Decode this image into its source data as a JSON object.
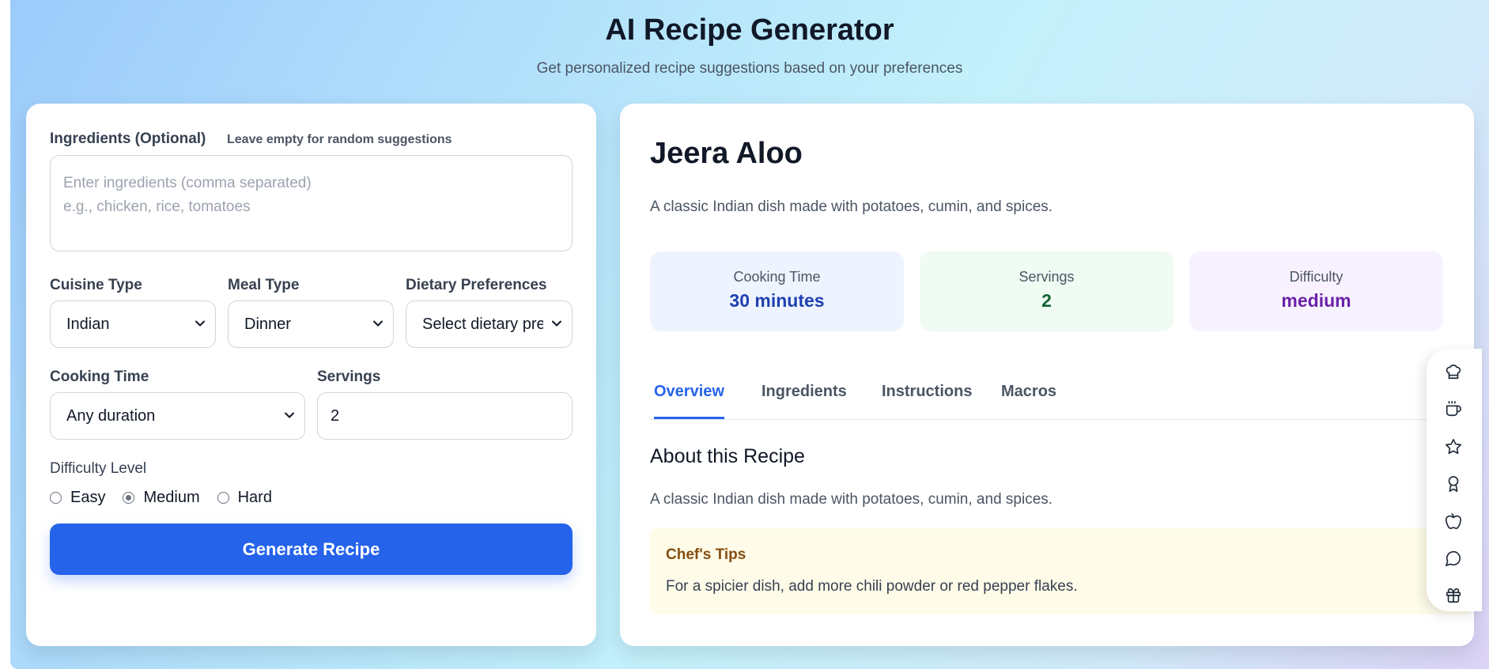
{
  "header": {
    "title": "AI Recipe Generator",
    "subtitle": "Get personalized recipe suggestions based on your preferences"
  },
  "form": {
    "ingredients_label": "Ingredients (Optional)",
    "ingredients_hint": "Leave empty for random suggestions",
    "ingredients_placeholder": "Enter ingredients (comma separated)\ne.g., chicken, rice, tomatoes",
    "ingredients_value": "",
    "cuisine_label": "Cuisine Type",
    "cuisine_value": "Indian",
    "meal_label": "Meal Type",
    "meal_value": "Dinner",
    "dietary_label": "Dietary Preferences",
    "dietary_value": "Select dietary preferences",
    "time_label": "Cooking Time",
    "time_value": "Any duration",
    "servings_label": "Servings",
    "servings_value": "2",
    "difficulty_label": "Difficulty Level",
    "difficulty_options": [
      "Easy",
      "Medium",
      "Hard"
    ],
    "difficulty_selected": "Medium",
    "generate_label": "Generate Recipe"
  },
  "recipe": {
    "title": "Jeera Aloo",
    "description": "A classic Indian dish made with potatoes, cumin, and spices.",
    "stats": {
      "time_label": "Cooking Time",
      "time_value": "30 minutes",
      "servings_label": "Servings",
      "servings_value": "2",
      "difficulty_label": "Difficulty",
      "difficulty_value": "medium"
    },
    "tabs": [
      "Overview",
      "Ingredients",
      "Instructions",
      "Macros"
    ],
    "active_tab": "Overview",
    "about_title": "About this Recipe",
    "about_text": "A classic Indian dish made with potatoes, cumin, and spices.",
    "tips_title": "Chef's Tips",
    "tips_text": "For a spicier dish, add more chili powder or red pepper flakes."
  },
  "sidebar": {
    "icons": [
      "chef-hat-icon",
      "coffee-icon",
      "star-icon",
      "award-icon",
      "apple-icon",
      "message-circle-icon",
      "gift-icon"
    ]
  },
  "colors": {
    "primary": "#2563eb",
    "time_value": "#1e40af",
    "servings_value": "#166534",
    "difficulty_value": "#6b21a8",
    "tips_title": "#854d0e"
  }
}
